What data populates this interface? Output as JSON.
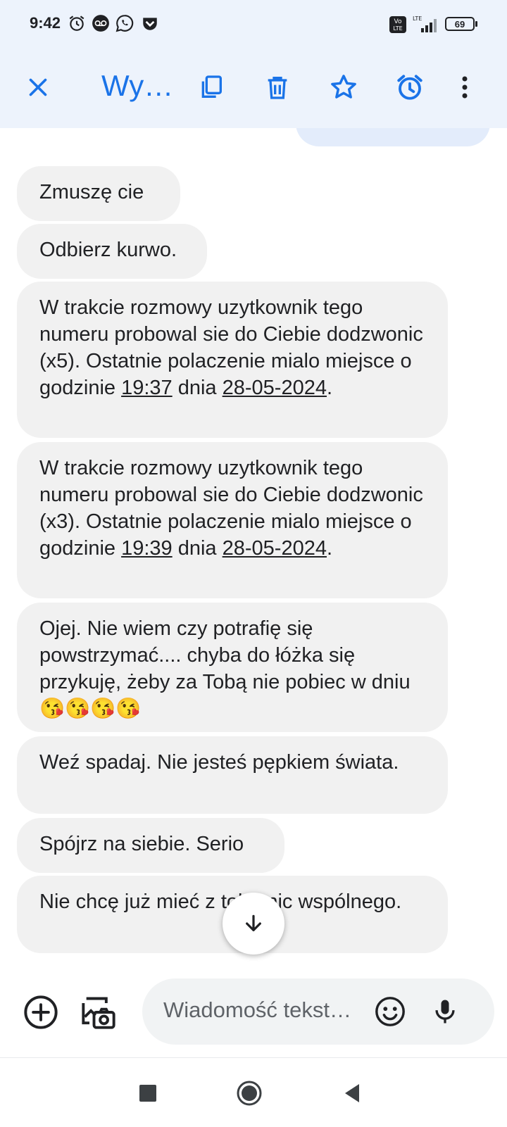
{
  "status_bar": {
    "time": "9:42",
    "battery": "69",
    "icons": [
      "alarm-icon",
      "voicemail-icon",
      "whatsapp-icon",
      "pocket-icon",
      "volte-icon",
      "lte-signal-icon",
      "battery-icon"
    ]
  },
  "app_bar": {
    "title": "Wy…",
    "icons": [
      "close-icon",
      "copy-icon",
      "delete-icon",
      "star-icon",
      "snooze-icon",
      "more-icon"
    ]
  },
  "messages": [
    {
      "parts": [
        "Zmuszę cie"
      ]
    },
    {
      "parts": [
        "Odbierz kurwo."
      ]
    },
    {
      "parts": [
        "W trakcie rozmowy uzytkownik tego numeru probowal sie do Ciebie dodzwonic (x5). Ostatnie polaczenie mialo miejsce o godzinie ",
        "19:37",
        " dnia ",
        "28-05-2024",
        "."
      ]
    },
    {
      "parts": [
        "W trakcie rozmowy uzytkownik tego numeru probowal sie do Ciebie dodzwonic (x3). Ostatnie polaczenie mialo miejsce o godzinie ",
        "19:39",
        " dnia ",
        "28-05-2024",
        "."
      ]
    },
    {
      "parts": [
        "Ojej. Nie wiem czy potrafię się powstrzymać.... chyba do łóżka się przykuję, żeby za Tobą nie pobiec w dniu 😘😘😘😘"
      ]
    },
    {
      "parts": [
        "Weź spadaj. Nie jesteś pępkiem świata."
      ]
    },
    {
      "parts": [
        "Spójrz na siebie. Serio"
      ]
    },
    {
      "parts": [
        "Nie chcę już mieć z tobą nic wspólnego."
      ]
    }
  ],
  "composer": {
    "placeholder": "Wiadomość tekst…",
    "icons": [
      "add-icon",
      "gallery-icon",
      "emoji-icon",
      "mic-icon"
    ]
  },
  "colors": {
    "accent": "#1a73e8",
    "incoming_bubble": "#f1f1f1",
    "header_bg": "#edf3fc"
  }
}
